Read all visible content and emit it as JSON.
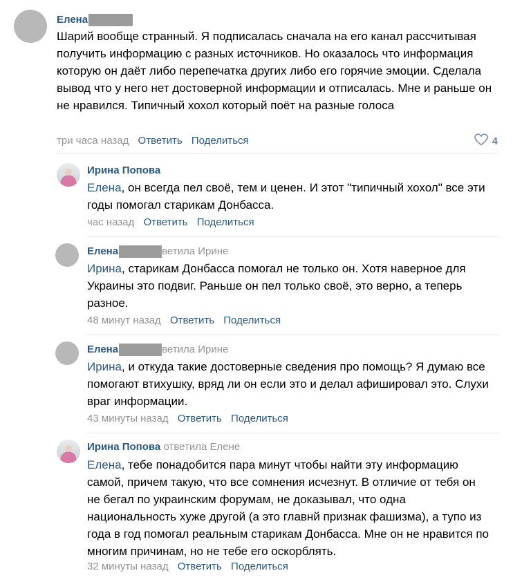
{
  "comments": [
    {
      "author": "Елена",
      "replied_to": "",
      "mention": "",
      "text": "Шарий вообще странный. Я подписалась сначала на его канал рассчитывая получить информацию с разных источников. Но оказалось что информация которую он даёт либо перепечатка других либо его горячие эмоции. Сделала вывод что у него нет достоверной информации и отписалась. Мне и раньше он не нравился. Типичный хохол который поёт на разные голоса",
      "time": "три часа назад",
      "reply_label": "Ответить",
      "share_label": "Поделиться",
      "likes": "4"
    },
    {
      "author": "Ирина Попова",
      "replied_to": "",
      "mention": "Елена",
      "text": ", он всегда пел своё, тем и ценен. И этот \"типичный хохол\" все эти годы помогал старикам Донбасса.",
      "time": "час назад",
      "reply_label": "Ответить",
      "share_label": "Поделиться"
    },
    {
      "author": "Елена",
      "replied_to": "ветила Ирине",
      "mention": "Ирина",
      "text": ", старикам Донбасса помогал не только он. Хотя наверное для Украины это подвиг. Раньше он пел только своё, это верно, а теперь разное.",
      "time": "48 минут назад",
      "reply_label": "Ответить",
      "share_label": "Поделиться"
    },
    {
      "author": "Елена",
      "replied_to": "ветила Ирине",
      "mention": "Ирина",
      "text": ", и откуда такие достоверные сведения про помощь? Я думаю все помогают втихушку, вряд ли он если это и делал афишировал это. Слухи враг информации.",
      "time": "43 минуты назад",
      "reply_label": "Ответить",
      "share_label": "Поделиться"
    },
    {
      "author": "Ирина Попова",
      "replied_to": "ответила Елене",
      "mention": "Елена",
      "text": ", тебе понадобится пара минут чтобы найти эту информацию самой, причем такую, что все сомнения исчезнут. В отличие от тебя он не бегал по украинским форумам, не доказывал, что одна национальность хуже другой (а это главнй признак фашизма), а тупо из года в год помогал реальным старикам Донбасса. Мне он не нравится по многим причинам, но не тебе его оскорблять.",
      "time": "32 минуты назад",
      "reply_label": "Ответить",
      "share_label": "Поделиться"
    }
  ],
  "icons": {
    "like": "heart-icon"
  }
}
